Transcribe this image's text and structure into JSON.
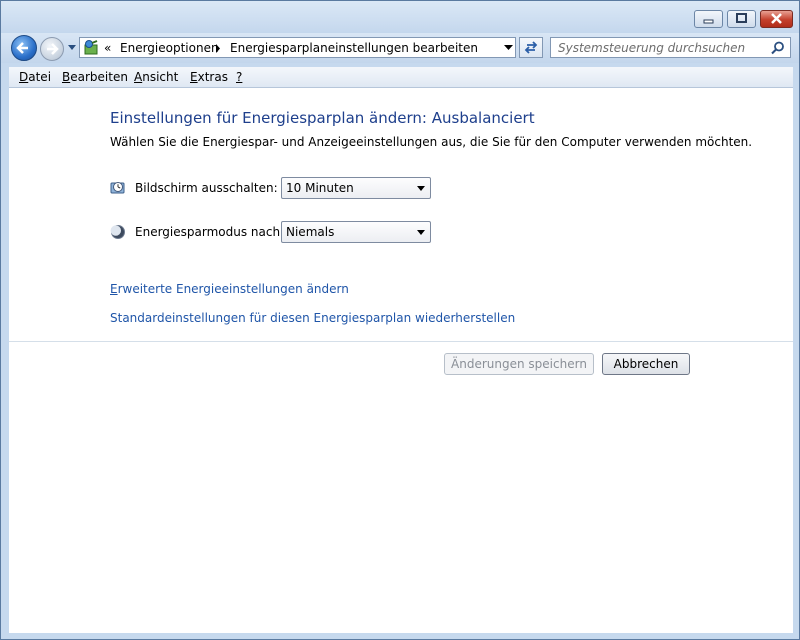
{
  "window": {
    "buttons": {
      "minimize": "minimize-icon",
      "maximize": "maximize-icon",
      "close": "close-icon"
    }
  },
  "nav": {
    "breadcrumb_prefix": "«",
    "breadcrumbs": [
      "Energieoptionen",
      "Energiesparplaneinstellungen bearbeiten"
    ],
    "search_placeholder": "Systemsteuerung durchsuchen"
  },
  "menu": {
    "items": [
      {
        "accel": "D",
        "rest": "atei"
      },
      {
        "accel": "B",
        "rest": "earbeiten"
      },
      {
        "accel": "A",
        "rest": "nsicht"
      },
      {
        "accel": "E",
        "rest": "xtras"
      },
      {
        "accel": "?",
        "rest": ""
      }
    ]
  },
  "main": {
    "title": "Einstellungen für Energiesparplan ändern: Ausbalanciert",
    "description": "Wählen Sie die Energiespar- und Anzeigeeinstellungen aus, die Sie für den Computer verwenden möchten.",
    "settings": [
      {
        "label": "Bildschirm ausschalten:",
        "value": "10 Minuten",
        "icon": "monitor-clock-icon"
      },
      {
        "label": "Energiesparmodus nach:",
        "value": "Niemals",
        "icon": "moon-icon"
      }
    ],
    "links": [
      {
        "accel": "E",
        "rest": "rweiterte Energieeinstellungen ändern"
      },
      {
        "accel": "",
        "rest": "Standardeinstellungen für diesen Energiesparplan wiederherstellen"
      }
    ],
    "buttons": {
      "save": "Änderungen speichern",
      "cancel": "Abbrechen"
    }
  },
  "colors": {
    "accent": "#1e3f8c",
    "link": "#1f55a8",
    "frame": "#c6d9ee"
  }
}
